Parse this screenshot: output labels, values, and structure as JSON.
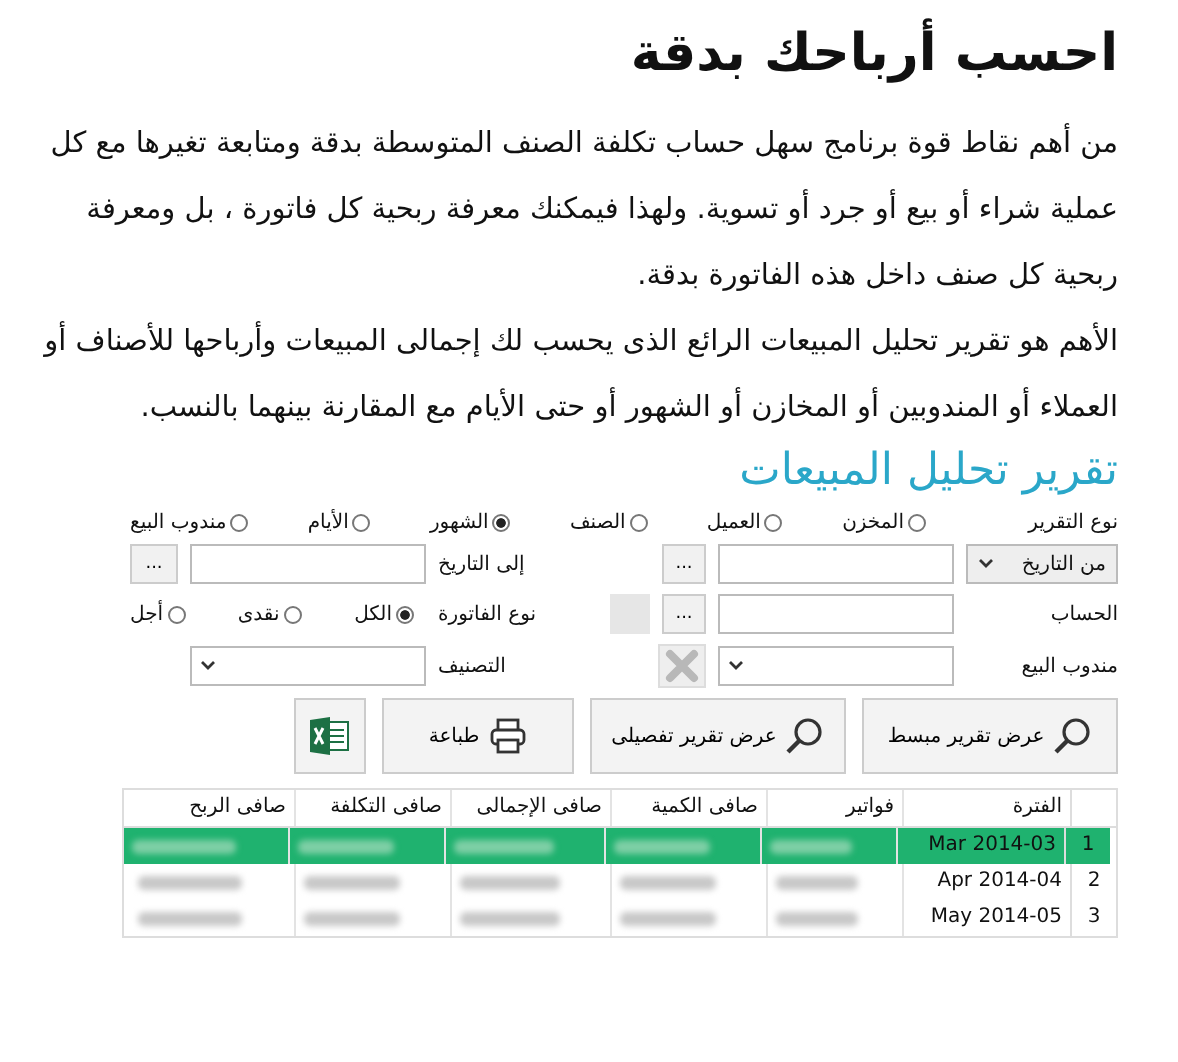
{
  "page": {
    "title": "احسب أرباحك بدقة",
    "paragraphs": [
      "من أهم نقاط قوة برنامج سهل حساب تكلفة الصنف المتوسطة بدقة ومتابعة تغيرها مع كل عملية شراء أو بيع أو جرد أو تسوية. ولهذا فيمكنك معرفة ربحية كل فاتورة ، بل ومعرفة ربحية كل صنف داخل هذه الفاتورة بدقة.",
      "الأهم هو تقرير تحليل المبيعات الرائع الذى يحسب لك إجمالى المبيعات وأرباحها للأصناف أو العملاء أو المندوبين أو المخازن أو الشهور أو حتى الأيام مع المقارنة بينهما بالنسب."
    ]
  },
  "report": {
    "title": "تقرير تحليل المبيعات",
    "report_type": {
      "label": "نوع التقرير",
      "options": [
        {
          "label": "المخزن",
          "selected": false
        },
        {
          "label": "العميل",
          "selected": false
        },
        {
          "label": "الصنف",
          "selected": false
        },
        {
          "label": "الشهور",
          "selected": true
        },
        {
          "label": "الأيام",
          "selected": false
        },
        {
          "label": "مندوب البيع",
          "selected": false
        }
      ]
    },
    "date_from": {
      "value": "من التاريخ",
      "browse": "..."
    },
    "date_to": {
      "label": "إلى التاريخ",
      "browse": "..."
    },
    "account": {
      "label": "الحساب",
      "browse": "..."
    },
    "invoice_type": {
      "label": "نوع الفاتورة",
      "options": [
        {
          "label": "الكل",
          "selected": true
        },
        {
          "label": "نقدى",
          "selected": false
        },
        {
          "label": "أجل",
          "selected": false
        }
      ]
    },
    "sales_rep": {
      "label": "مندوب البيع"
    },
    "category": {
      "label": "التصنيف"
    },
    "buttons": [
      {
        "kind": "search",
        "label": "عرض تقرير مبسط"
      },
      {
        "kind": "search",
        "label": "عرض تقرير تفصيلى"
      },
      {
        "kind": "print",
        "label": "طباعة"
      },
      {
        "kind": "excel"
      }
    ],
    "table": {
      "columns": [
        "الفترة",
        "فواتير",
        "صافى الكمية",
        "صافى الإجمالى",
        "صافى التكلفة",
        "صافى الربح"
      ],
      "rows": [
        {
          "index": "1",
          "period": "Mar 2014-03",
          "selected": true
        },
        {
          "index": "2",
          "period": "Apr 2014-04",
          "selected": false
        },
        {
          "index": "3",
          "period": "May 2014-05",
          "selected": false
        }
      ]
    }
  }
}
